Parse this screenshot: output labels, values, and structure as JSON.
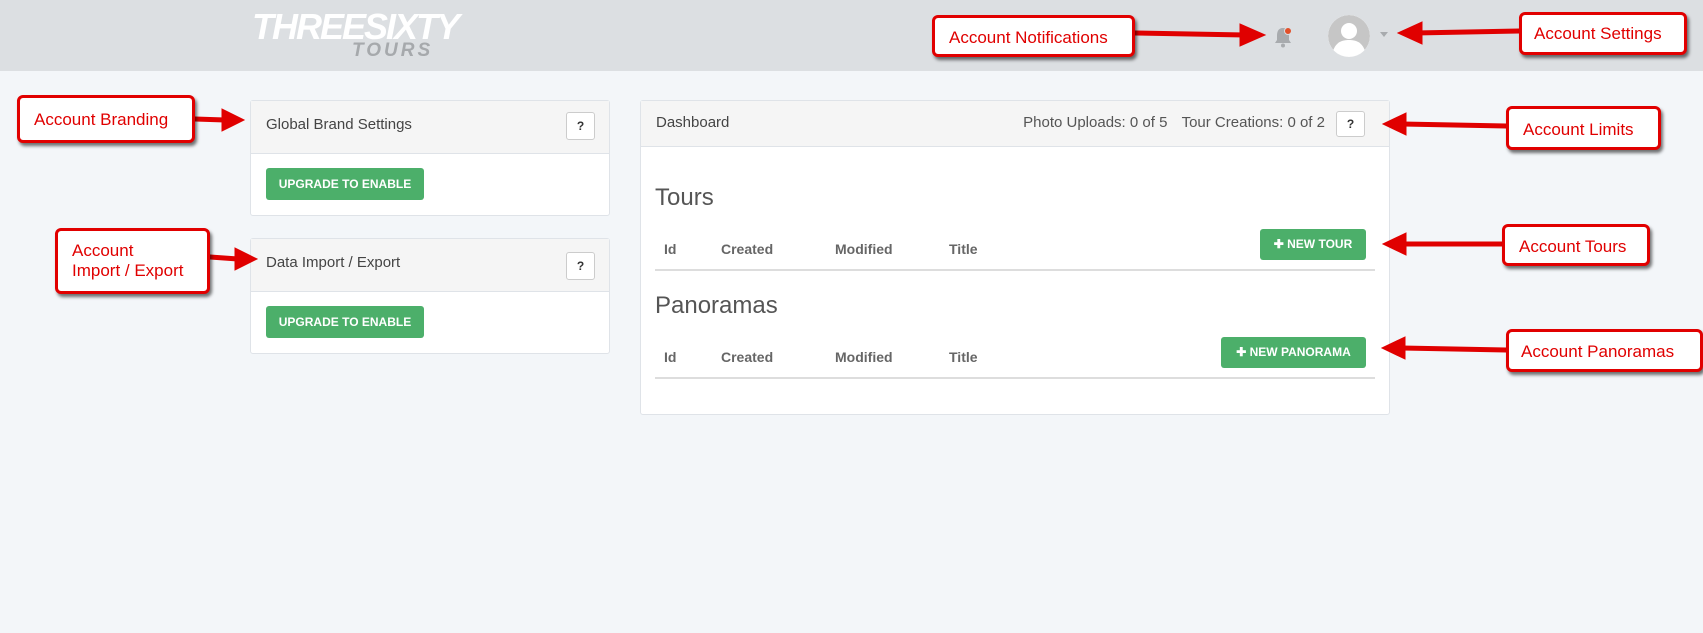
{
  "header": {
    "logo_top": "THREESIXTY",
    "logo_bottom": "TOURS",
    "icons": [
      "bell-icon",
      "user-avatar-icon",
      "caret-down-icon"
    ]
  },
  "brand_panel": {
    "title": "Global Brand Settings",
    "help_label": "?",
    "button_label": "UPGRADE TO ENABLE"
  },
  "import_panel": {
    "title": "Data Import / Export",
    "help_label": "?",
    "button_label": "UPGRADE TO ENABLE"
  },
  "dashboard": {
    "title": "Dashboard",
    "photo_uploads": "Photo Uploads: 0 of 5",
    "tour_creations": "Tour Creations: 0 of 2",
    "help_label": "?",
    "tours": {
      "title": "Tours",
      "columns": [
        "Id",
        "Created",
        "Modified",
        "Title"
      ],
      "new_button": "NEW TOUR"
    },
    "panoramas": {
      "title": "Panoramas",
      "columns": [
        "Id",
        "Created",
        "Modified",
        "Title"
      ],
      "new_button": "NEW PANORAMA"
    }
  },
  "callouts": {
    "notifications": "Account Notifications",
    "settings": "Account Settings",
    "branding": "Account Branding",
    "import_line1": "Account",
    "import_line2": "Import / Export",
    "limits": "Account Limits",
    "tours": "Account Tours",
    "panoramas": "Account Panoramas"
  },
  "colors": {
    "topbar": "#dcdfe2",
    "background": "#f3f6f9",
    "green_button": "#4caf6a",
    "callout_red": "#e00000"
  }
}
